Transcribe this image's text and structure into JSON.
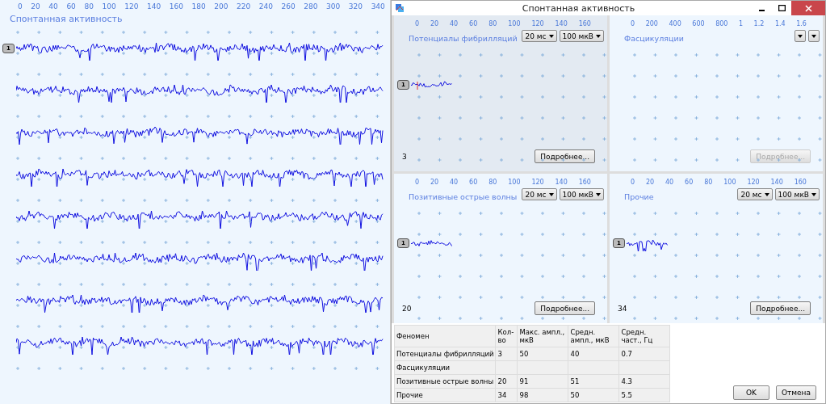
{
  "main": {
    "title": "Спонтанная активность",
    "axis_labels": [
      "0",
      "20",
      "40",
      "60",
      "80",
      "100",
      "120",
      "140",
      "160",
      "180",
      "200",
      "220",
      "240",
      "260",
      "280",
      "300",
      "320",
      "340"
    ],
    "traces": [
      {
        "kind": "channel",
        "badge": "1"
      },
      {
        "kind": "channel"
      },
      {
        "kind": "channel"
      },
      {
        "kind": "channel"
      },
      {
        "kind": "channel"
      },
      {
        "kind": "channel"
      },
      {
        "kind": "channel"
      },
      {
        "kind": "channel"
      }
    ]
  },
  "dialog": {
    "title": "Спонтанная активность",
    "panels": [
      {
        "title": "Потенциалы фибрилляций",
        "selected": true,
        "axis_labels": [
          "0",
          "20",
          "40",
          "60",
          "80",
          "100",
          "120",
          "140",
          "160"
        ],
        "dropdowns": [
          {
            "kind": "labeled",
            "label": "20 мс"
          },
          {
            "kind": "labeled",
            "label": "100 мкВ"
          }
        ],
        "badge": "1",
        "count": "3",
        "details_button": {
          "label": "Подробнее...",
          "disabled": false
        }
      },
      {
        "title": "Фасцикуляции",
        "selected": false,
        "axis_labels": [
          "0",
          "200",
          "400",
          "600",
          "800",
          "1",
          "1.2",
          "1.4",
          "1.6"
        ],
        "dropdowns": [
          {
            "kind": "blank"
          },
          {
            "kind": "blank"
          }
        ],
        "details_button": {
          "label": "Подробнее...",
          "disabled": true
        }
      },
      {
        "title": "Позитивные острые волны",
        "selected": false,
        "axis_labels": [
          "0",
          "20",
          "40",
          "60",
          "80",
          "100",
          "120",
          "140",
          "160"
        ],
        "dropdowns": [
          {
            "kind": "labeled",
            "label": "20 мс"
          },
          {
            "kind": "labeled",
            "label": "100 мкВ"
          }
        ],
        "badge": "1",
        "count": "20",
        "details_button": {
          "label": "Подробнее...",
          "disabled": false
        }
      },
      {
        "title": "Прочие",
        "selected": false,
        "axis_labels": [
          "0",
          "20",
          "40",
          "60",
          "80",
          "100",
          "120",
          "140",
          "160"
        ],
        "dropdowns": [
          {
            "kind": "labeled",
            "label": "20 мс"
          },
          {
            "kind": "labeled",
            "label": "100 мкВ"
          }
        ],
        "badge": "1",
        "count": "34",
        "details_button": {
          "label": "Подробнее...",
          "disabled": false
        }
      }
    ],
    "table": {
      "columns": [
        "Феномен",
        "Кол-во",
        "Макс. ампл., мкВ",
        "Средн. ампл., мкВ",
        "Средн. част., Гц"
      ],
      "rows": [
        [
          "Потенциалы фибрилляций",
          "3",
          "50",
          "40",
          "0.7"
        ],
        [
          "Фасцикуляции",
          "",
          "",
          "",
          ""
        ],
        [
          "Позитивные острые волны",
          "20",
          "91",
          "51",
          "4.3"
        ],
        [
          "Прочие",
          "34",
          "98",
          "50",
          "5.5"
        ]
      ]
    },
    "buttons": [
      "OK",
      "Отмена"
    ]
  }
}
